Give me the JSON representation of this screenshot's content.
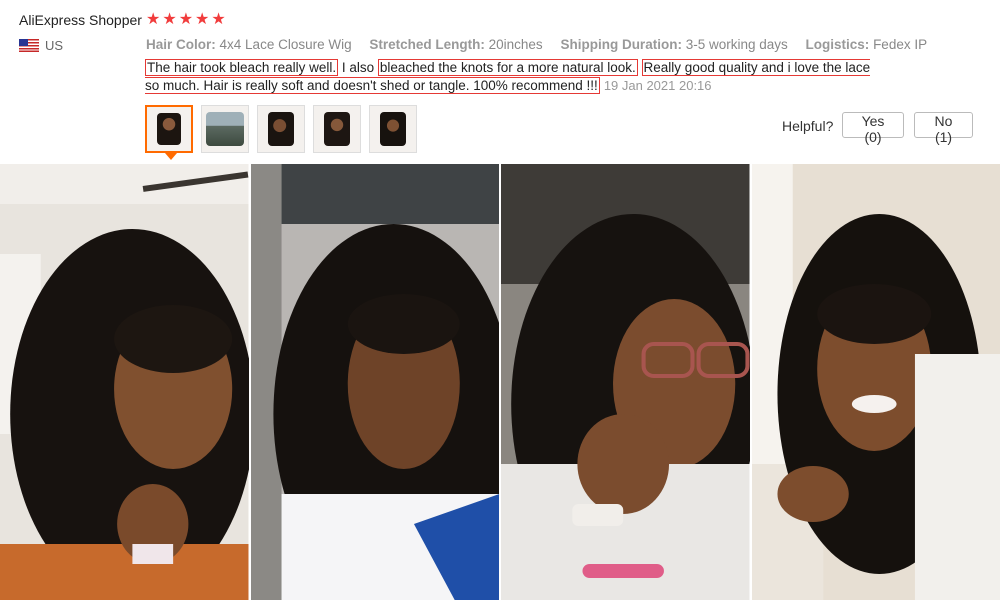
{
  "reviewer": {
    "name": "AliExpress Shopper",
    "country": "US",
    "rating": 5
  },
  "attributes": [
    {
      "key": "Hair Color:",
      "value": "4x4 Lace Closure Wig"
    },
    {
      "key": "Stretched Length:",
      "value": "20inches"
    },
    {
      "key": "Shipping Duration:",
      "value": "3-5 working days"
    },
    {
      "key": "Logistics:",
      "value": "Fedex IP"
    }
  ],
  "review": {
    "part1": "The hair took bleach really well.",
    "part2": " I also ",
    "part3": "bleached the knots for a more natural look.",
    "part4": " ",
    "part5": "Really good quality and i love the lace so much. Hair is really soft and doesn't shed or tangle. 100% recommend !!!",
    "date": "19 Jan 2021 20:16"
  },
  "helpful": {
    "label": "Helpful?",
    "yes": "Yes (0)",
    "no": "No (1)"
  },
  "colors": {
    "star": "#f13c3c",
    "highlight": "#e53935",
    "active_thumb": "#ff6a00"
  }
}
